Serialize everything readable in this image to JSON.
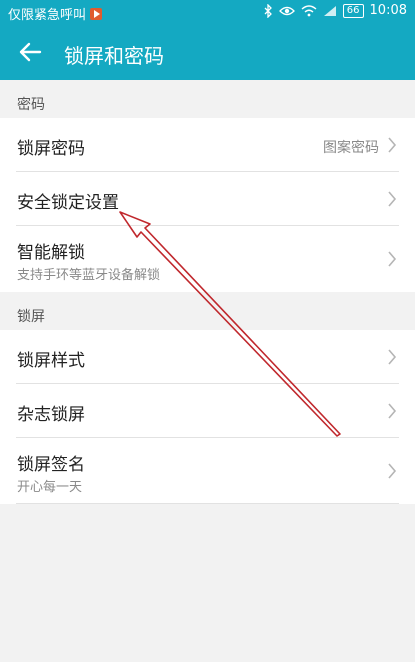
{
  "status_bar": {
    "carrier_text": "仅限紧急呼叫",
    "battery": "66",
    "time": "10:08",
    "icons": [
      "play-icon",
      "bluetooth-icon",
      "eye-icon",
      "wifi-icon",
      "sim-icon",
      "battery-icon"
    ]
  },
  "app_bar": {
    "title": "锁屏和密码",
    "back_icon": "back-arrow-icon"
  },
  "sections": [
    {
      "header": "密码",
      "items": [
        {
          "title": "锁屏密码",
          "value": "图案密码"
        },
        {
          "title": "安全锁定设置"
        },
        {
          "title": "智能解锁",
          "subtitle": "支持手环等蓝牙设备解锁"
        }
      ]
    },
    {
      "header": "锁屏",
      "items": [
        {
          "title": "锁屏样式"
        },
        {
          "title": "杂志锁屏"
        },
        {
          "title": "锁屏签名",
          "subtitle": "开心每一天"
        }
      ]
    }
  ],
  "colors": {
    "accent": "#14a9c2",
    "annotation_arrow": "#c0282d"
  }
}
